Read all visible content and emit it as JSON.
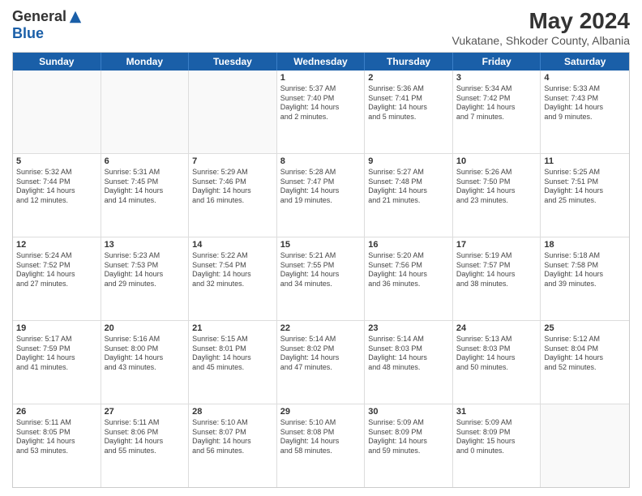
{
  "header": {
    "logo_general": "General",
    "logo_blue": "Blue",
    "month_year": "May 2024",
    "location": "Vukatane, Shkoder County, Albania"
  },
  "weekdays": [
    "Sunday",
    "Monday",
    "Tuesday",
    "Wednesday",
    "Thursday",
    "Friday",
    "Saturday"
  ],
  "weeks": [
    [
      {
        "day": "",
        "lines": []
      },
      {
        "day": "",
        "lines": []
      },
      {
        "day": "",
        "lines": []
      },
      {
        "day": "1",
        "lines": [
          "Sunrise: 5:37 AM",
          "Sunset: 7:40 PM",
          "Daylight: 14 hours",
          "and 2 minutes."
        ]
      },
      {
        "day": "2",
        "lines": [
          "Sunrise: 5:36 AM",
          "Sunset: 7:41 PM",
          "Daylight: 14 hours",
          "and 5 minutes."
        ]
      },
      {
        "day": "3",
        "lines": [
          "Sunrise: 5:34 AM",
          "Sunset: 7:42 PM",
          "Daylight: 14 hours",
          "and 7 minutes."
        ]
      },
      {
        "day": "4",
        "lines": [
          "Sunrise: 5:33 AM",
          "Sunset: 7:43 PM",
          "Daylight: 14 hours",
          "and 9 minutes."
        ]
      }
    ],
    [
      {
        "day": "5",
        "lines": [
          "Sunrise: 5:32 AM",
          "Sunset: 7:44 PM",
          "Daylight: 14 hours",
          "and 12 minutes."
        ]
      },
      {
        "day": "6",
        "lines": [
          "Sunrise: 5:31 AM",
          "Sunset: 7:45 PM",
          "Daylight: 14 hours",
          "and 14 minutes."
        ]
      },
      {
        "day": "7",
        "lines": [
          "Sunrise: 5:29 AM",
          "Sunset: 7:46 PM",
          "Daylight: 14 hours",
          "and 16 minutes."
        ]
      },
      {
        "day": "8",
        "lines": [
          "Sunrise: 5:28 AM",
          "Sunset: 7:47 PM",
          "Daylight: 14 hours",
          "and 19 minutes."
        ]
      },
      {
        "day": "9",
        "lines": [
          "Sunrise: 5:27 AM",
          "Sunset: 7:48 PM",
          "Daylight: 14 hours",
          "and 21 minutes."
        ]
      },
      {
        "day": "10",
        "lines": [
          "Sunrise: 5:26 AM",
          "Sunset: 7:50 PM",
          "Daylight: 14 hours",
          "and 23 minutes."
        ]
      },
      {
        "day": "11",
        "lines": [
          "Sunrise: 5:25 AM",
          "Sunset: 7:51 PM",
          "Daylight: 14 hours",
          "and 25 minutes."
        ]
      }
    ],
    [
      {
        "day": "12",
        "lines": [
          "Sunrise: 5:24 AM",
          "Sunset: 7:52 PM",
          "Daylight: 14 hours",
          "and 27 minutes."
        ]
      },
      {
        "day": "13",
        "lines": [
          "Sunrise: 5:23 AM",
          "Sunset: 7:53 PM",
          "Daylight: 14 hours",
          "and 29 minutes."
        ]
      },
      {
        "day": "14",
        "lines": [
          "Sunrise: 5:22 AM",
          "Sunset: 7:54 PM",
          "Daylight: 14 hours",
          "and 32 minutes."
        ]
      },
      {
        "day": "15",
        "lines": [
          "Sunrise: 5:21 AM",
          "Sunset: 7:55 PM",
          "Daylight: 14 hours",
          "and 34 minutes."
        ]
      },
      {
        "day": "16",
        "lines": [
          "Sunrise: 5:20 AM",
          "Sunset: 7:56 PM",
          "Daylight: 14 hours",
          "and 36 minutes."
        ]
      },
      {
        "day": "17",
        "lines": [
          "Sunrise: 5:19 AM",
          "Sunset: 7:57 PM",
          "Daylight: 14 hours",
          "and 38 minutes."
        ]
      },
      {
        "day": "18",
        "lines": [
          "Sunrise: 5:18 AM",
          "Sunset: 7:58 PM",
          "Daylight: 14 hours",
          "and 39 minutes."
        ]
      }
    ],
    [
      {
        "day": "19",
        "lines": [
          "Sunrise: 5:17 AM",
          "Sunset: 7:59 PM",
          "Daylight: 14 hours",
          "and 41 minutes."
        ]
      },
      {
        "day": "20",
        "lines": [
          "Sunrise: 5:16 AM",
          "Sunset: 8:00 PM",
          "Daylight: 14 hours",
          "and 43 minutes."
        ]
      },
      {
        "day": "21",
        "lines": [
          "Sunrise: 5:15 AM",
          "Sunset: 8:01 PM",
          "Daylight: 14 hours",
          "and 45 minutes."
        ]
      },
      {
        "day": "22",
        "lines": [
          "Sunrise: 5:14 AM",
          "Sunset: 8:02 PM",
          "Daylight: 14 hours",
          "and 47 minutes."
        ]
      },
      {
        "day": "23",
        "lines": [
          "Sunrise: 5:14 AM",
          "Sunset: 8:03 PM",
          "Daylight: 14 hours",
          "and 48 minutes."
        ]
      },
      {
        "day": "24",
        "lines": [
          "Sunrise: 5:13 AM",
          "Sunset: 8:03 PM",
          "Daylight: 14 hours",
          "and 50 minutes."
        ]
      },
      {
        "day": "25",
        "lines": [
          "Sunrise: 5:12 AM",
          "Sunset: 8:04 PM",
          "Daylight: 14 hours",
          "and 52 minutes."
        ]
      }
    ],
    [
      {
        "day": "26",
        "lines": [
          "Sunrise: 5:11 AM",
          "Sunset: 8:05 PM",
          "Daylight: 14 hours",
          "and 53 minutes."
        ]
      },
      {
        "day": "27",
        "lines": [
          "Sunrise: 5:11 AM",
          "Sunset: 8:06 PM",
          "Daylight: 14 hours",
          "and 55 minutes."
        ]
      },
      {
        "day": "28",
        "lines": [
          "Sunrise: 5:10 AM",
          "Sunset: 8:07 PM",
          "Daylight: 14 hours",
          "and 56 minutes."
        ]
      },
      {
        "day": "29",
        "lines": [
          "Sunrise: 5:10 AM",
          "Sunset: 8:08 PM",
          "Daylight: 14 hours",
          "and 58 minutes."
        ]
      },
      {
        "day": "30",
        "lines": [
          "Sunrise: 5:09 AM",
          "Sunset: 8:09 PM",
          "Daylight: 14 hours",
          "and 59 minutes."
        ]
      },
      {
        "day": "31",
        "lines": [
          "Sunrise: 5:09 AM",
          "Sunset: 8:09 PM",
          "Daylight: 15 hours",
          "and 0 minutes."
        ]
      },
      {
        "day": "",
        "lines": []
      }
    ]
  ]
}
